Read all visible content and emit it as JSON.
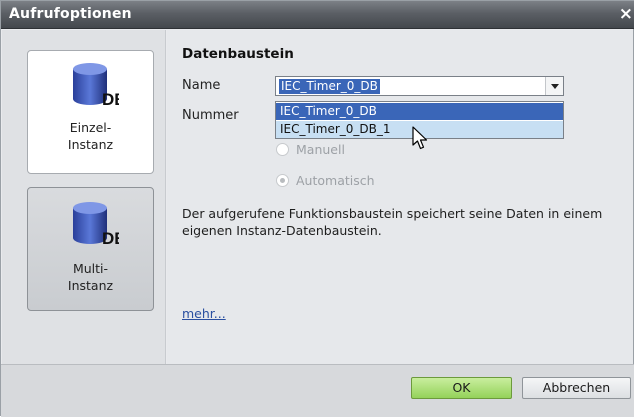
{
  "window": {
    "title": "Aufrufoptionen",
    "close_label": "×"
  },
  "left": {
    "options": [
      {
        "label_line1": "Einzel-",
        "label_line2": "Instanz",
        "icon_text": "DB",
        "selected": false
      },
      {
        "label_line1": "Multi-",
        "label_line2": "Instanz",
        "icon_text": "DB",
        "selected": true
      }
    ]
  },
  "main": {
    "section_title": "Datenbaustein",
    "name_label": "Name",
    "name_value": "IEC_Timer_0_DB",
    "nummer_label": "Nummer",
    "dropdown_options": [
      "IEC_Timer_0_DB",
      "IEC_Timer_0_DB_1"
    ],
    "radio_manuell": "Manuell",
    "radio_automatisch": "Automatisch",
    "description": "Der aufgerufene Funktionsbaustein speichert seine Daten in einem eigenen Instanz-Datenbaustein.",
    "more_link": "mehr..."
  },
  "footer": {
    "ok_label": "OK",
    "cancel_label": "Abbrechen"
  },
  "colors": {
    "selection": "#3a66b8",
    "hover": "#c7dff3",
    "ok_button": "#a9dc74",
    "titlebar": "#55595f"
  }
}
